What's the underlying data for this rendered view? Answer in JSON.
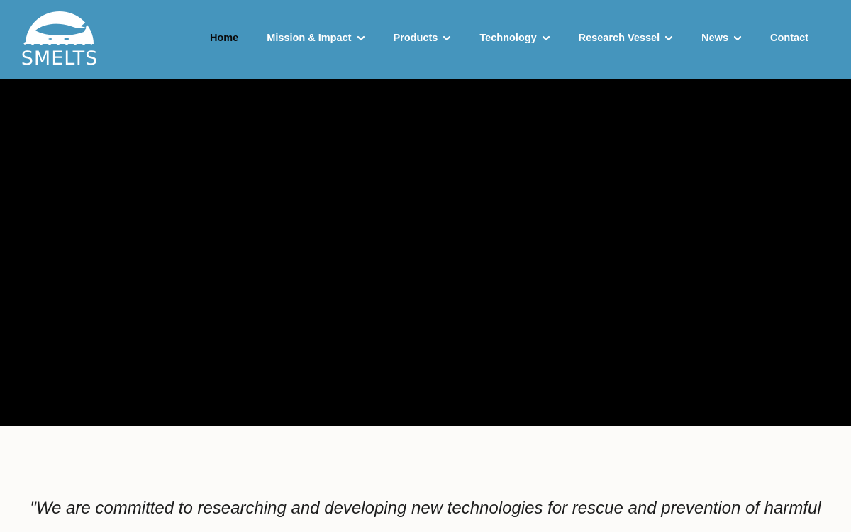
{
  "header": {
    "logo_text": "SMELTS",
    "background": "#4595bd"
  },
  "nav": {
    "items": [
      {
        "label": "Home",
        "active": true,
        "has_dropdown": false
      },
      {
        "label": "Mission & Impact",
        "active": false,
        "has_dropdown": true
      },
      {
        "label": "Products",
        "active": false,
        "has_dropdown": true
      },
      {
        "label": "Technology",
        "active": false,
        "has_dropdown": true
      },
      {
        "label": "Research Vessel",
        "active": false,
        "has_dropdown": true
      },
      {
        "label": "News",
        "active": false,
        "has_dropdown": true
      },
      {
        "label": "Contact",
        "active": false,
        "has_dropdown": false
      }
    ]
  },
  "hero": {
    "background": "#000000"
  },
  "quote": {
    "text": "\"We are committed to researching and developing new technologies for rescue and prevention of harmful"
  }
}
